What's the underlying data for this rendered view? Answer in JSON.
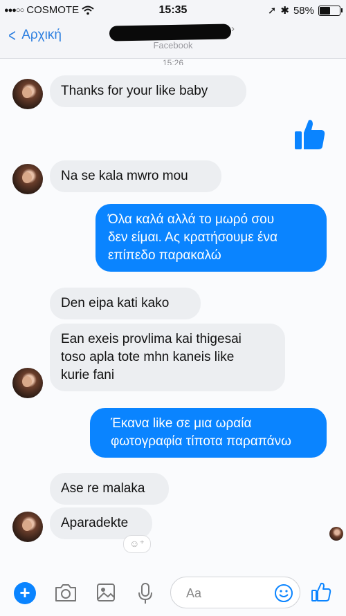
{
  "status_bar": {
    "signal": "●●●○○",
    "carrier": "COSMOTE",
    "time": "15:35",
    "bluetooth": "✱",
    "location_arrow": "➚",
    "battery_percent": "58%",
    "battery_level": 0.58
  },
  "nav": {
    "back_label": "Αρχική",
    "subtitle": "Facebook"
  },
  "timestamp": "15:26",
  "messages": [
    {
      "side": "in",
      "text": "Thanks for your like baby"
    },
    {
      "side": "out",
      "type": "like-icon"
    },
    {
      "side": "in",
      "text": "Na se kala mwro mou"
    },
    {
      "side": "out",
      "lines": [
        "Όλα καλά αλλά το μωρό σου",
        "δεν είμαι. Ας κρατήσουμε ένα",
        "επίπεδο παρακαλώ"
      ]
    },
    {
      "side": "in",
      "text": "Den eipa kati kako"
    },
    {
      "side": "in",
      "lines": [
        "Ean exeis provlima kai thigesai",
        "toso apla tote mhn kaneis like",
        "kurie fani"
      ]
    },
    {
      "side": "out",
      "lines": [
        "Έκανα like σε μια ωραία",
        "φωτογραφία τίποτα παραπάνω"
      ]
    },
    {
      "side": "in",
      "text": "Ase re malaka"
    },
    {
      "side": "in",
      "text": "Aparadekte"
    }
  ],
  "composer": {
    "placeholder": "Aa",
    "icons": [
      "plus-icon",
      "camera-icon",
      "gallery-icon",
      "microphone-icon",
      "emoji-icon",
      "thumbs-up-icon"
    ]
  },
  "colors": {
    "accent": "#0a84ff",
    "incoming_bubble": "#eceef1",
    "link_blue": "#2d7fe0"
  }
}
